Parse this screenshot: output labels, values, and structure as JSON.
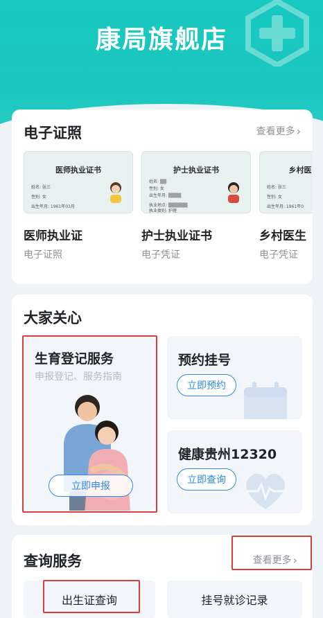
{
  "header": {
    "title": "康局旗舰店"
  },
  "certificates": {
    "title": "电子证照",
    "more_label": "查看更多",
    "items": [
      {
        "card_heading": "医师执业证书",
        "name": "医师执业证",
        "type": "电子证照"
      },
      {
        "card_heading": "护士执业证书",
        "name": "护士执业证书",
        "type": "电子凭证"
      },
      {
        "card_heading": "乡村医",
        "name": "乡村医生",
        "type": "电子凭证"
      }
    ]
  },
  "care": {
    "title": "大家关心",
    "birth": {
      "title": "生育登记服务",
      "subtitle": "申报登记、服务指南",
      "button": "立即申报"
    },
    "appointment": {
      "title": "预约挂号",
      "button": "立即预约"
    },
    "hotline": {
      "title": "健康贵州12320",
      "button": "立即查询"
    }
  },
  "query": {
    "title": "查询服务",
    "more_label": "查看更多",
    "items": [
      "出生证查询",
      "挂号就诊记录"
    ]
  },
  "colors": {
    "brand": "#1cc6bd",
    "accent": "#2c8aea",
    "highlight": "#e03b3b"
  }
}
